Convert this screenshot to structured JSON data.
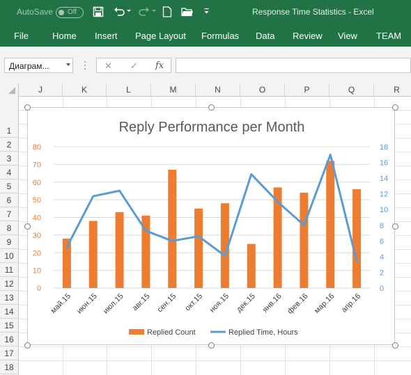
{
  "titlebar": {
    "autosave_label": "AutoSave",
    "autosave_state": "Off",
    "window_title": "Response Time Statistics  -  Excel",
    "qat": {
      "save_icon": "save-icon",
      "undo_icon": "undo-icon",
      "redo_icon": "redo-icon",
      "new_icon": "new-file-icon",
      "open_icon": "open-folder-icon",
      "customize_icon": "customize-qat-icon"
    }
  },
  "ribbon": {
    "tabs": [
      "File",
      "Home",
      "Insert",
      "Page Layout",
      "Formulas",
      "Data",
      "Review",
      "View",
      "TEAM"
    ]
  },
  "formula_bar": {
    "name_box": "Диаграм...",
    "cancel_symbol": "✕",
    "enter_symbol": "✓",
    "fx_symbol": "fx",
    "value": ""
  },
  "grid": {
    "columns": [
      "J",
      "K",
      "L",
      "M",
      "N",
      "O",
      "P",
      "Q",
      "R"
    ],
    "rows": [
      "1",
      "2",
      "3",
      "4",
      "5",
      "6",
      "7",
      "8",
      "9",
      "10",
      "11",
      "12",
      "13",
      "14",
      "15",
      "16",
      "17",
      "18"
    ]
  },
  "chart_data": {
    "type": "bar",
    "title": "Reply Performance per Month",
    "categories": [
      "май.15",
      "июн.15",
      "июл.15",
      "авг.15",
      "сен.15",
      "окт.15",
      "ноя.15",
      "дек.15",
      "янв.16",
      "фев.16",
      "мар.16",
      "апр.16"
    ],
    "series": [
      {
        "name": "Replied Count",
        "type": "bar",
        "axis": "left",
        "color": "#ED7D31",
        "values": [
          28,
          38,
          43,
          41,
          67,
          45,
          48,
          25,
          57,
          54,
          72,
          56
        ]
      },
      {
        "name": "Replied Time, Hours",
        "type": "line",
        "axis": "right",
        "color": "#5B9BD5",
        "values": [
          5.2,
          11.7,
          12.4,
          7.3,
          6.0,
          6.6,
          4.1,
          14.5,
          11.0,
          8.0,
          17.0,
          3.4
        ]
      }
    ],
    "ylim_left": [
      0,
      80
    ],
    "yticks_left": [
      "0",
      "10",
      "20",
      "30",
      "40",
      "50",
      "60",
      "70",
      "80"
    ],
    "ylim_right": [
      0,
      18
    ],
    "yticks_right": [
      "0",
      "2",
      "4",
      "6",
      "8",
      "10",
      "12",
      "14",
      "16",
      "18"
    ],
    "legend_position": "bottom",
    "grid": true
  }
}
